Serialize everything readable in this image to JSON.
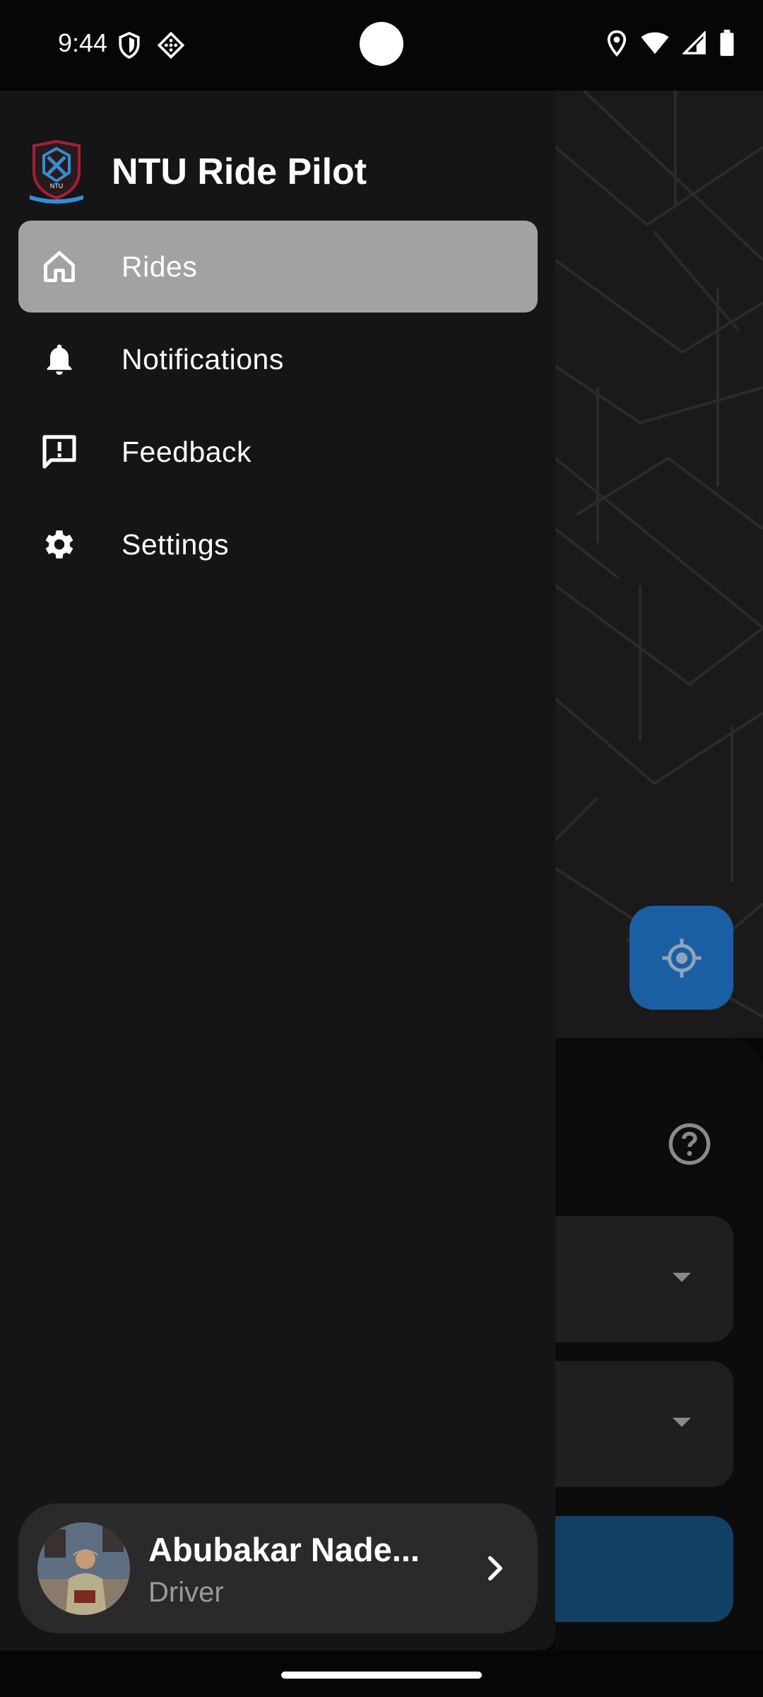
{
  "status_bar": {
    "time": "9:44",
    "left_icons": [
      "shield-icon",
      "apps-grid-icon"
    ],
    "right_icons": [
      "location-icon",
      "wifi-icon",
      "signal-icon",
      "battery-icon"
    ]
  },
  "drawer": {
    "app_title": "NTU Ride Pilot",
    "logo": "ntu-crest-logo",
    "nav_items": [
      {
        "label": "Rides",
        "icon": "home-icon",
        "active": true
      },
      {
        "label": "Notifications",
        "icon": "bell-icon",
        "active": false
      },
      {
        "label": "Feedback",
        "icon": "feedback-icon",
        "active": false
      },
      {
        "label": "Settings",
        "icon": "gear-icon",
        "active": false
      }
    ],
    "profile": {
      "name": "Abubakar Nade...",
      "role": "Driver",
      "icon": "chevron-right-icon"
    }
  },
  "background_screen": {
    "fab_icon": "my-location-icon",
    "help_icon": "help-circle-icon",
    "dropdown_icon": "arrow-drop-down-icon"
  },
  "colors": {
    "drawer_bg": "#151515",
    "active_item": "#a2a2a2",
    "accent_blue": "#1a5fa3",
    "profile_card": "#2a2a2a"
  }
}
